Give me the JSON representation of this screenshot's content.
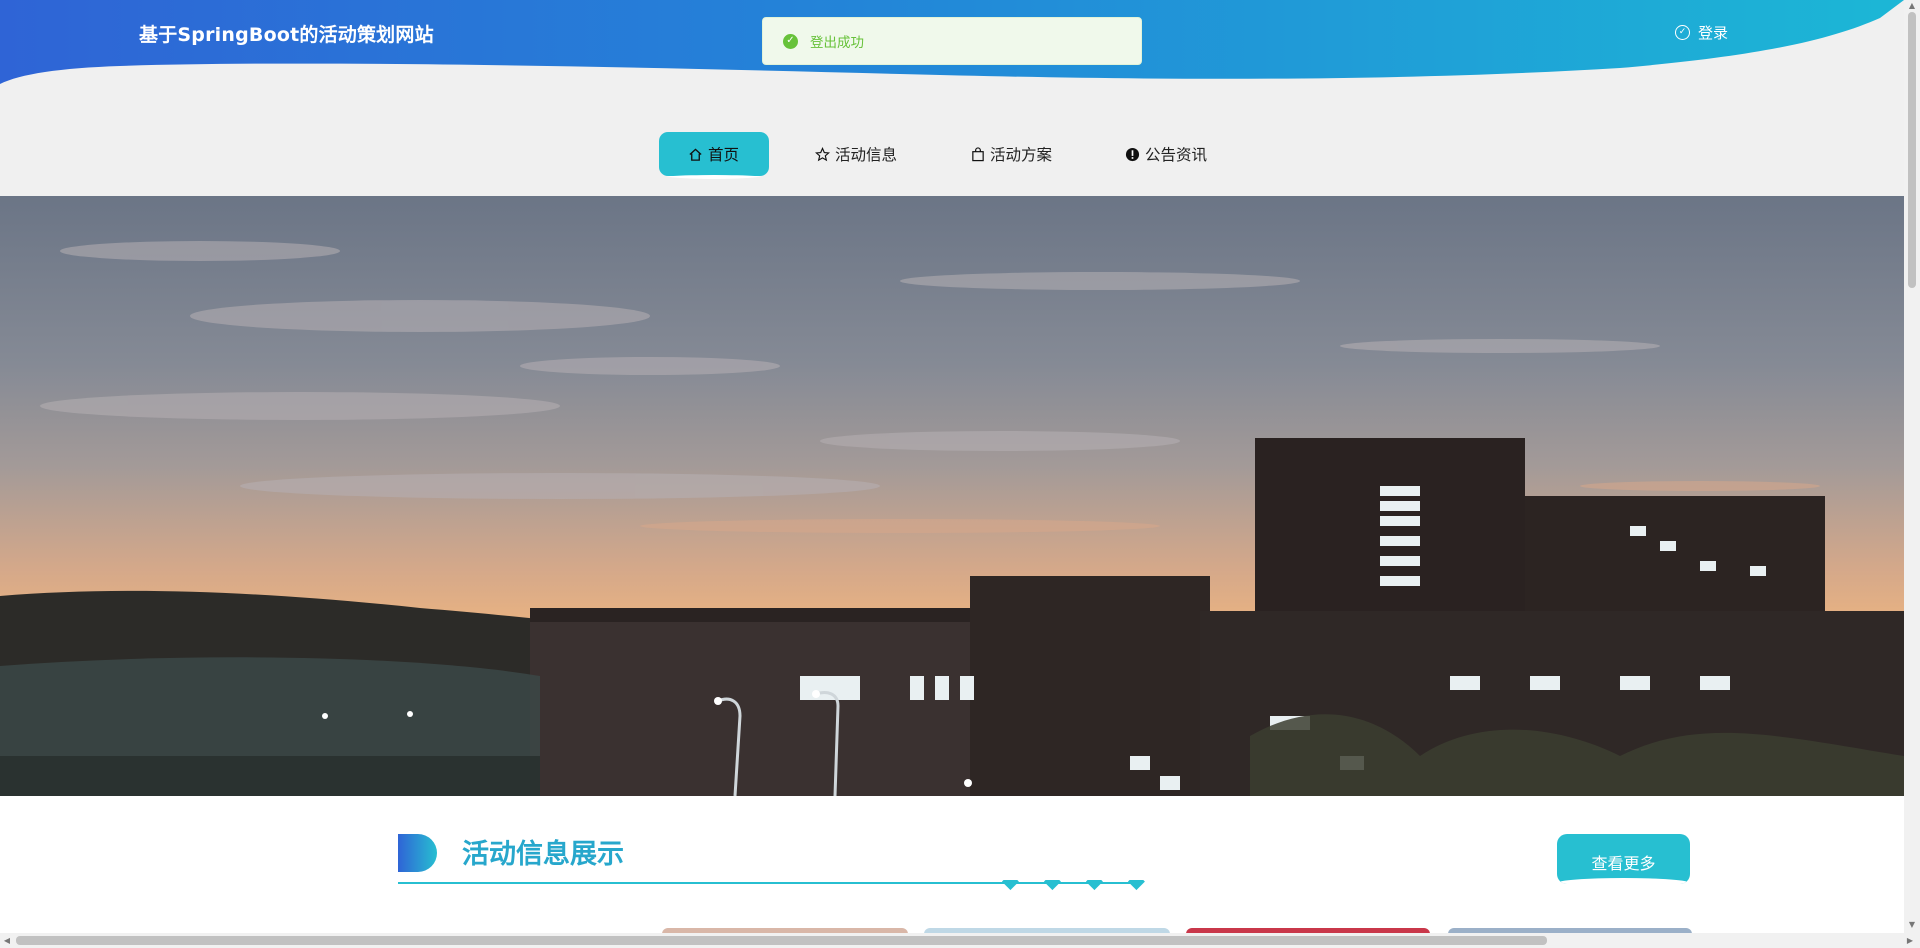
{
  "header": {
    "site_title": "基于SpringBoot的活动策划网站",
    "login_label": "登录"
  },
  "toast": {
    "message": "登出成功"
  },
  "nav": {
    "items": [
      {
        "label": "首页",
        "icon": "home-icon",
        "active": true
      },
      {
        "label": "活动信息",
        "icon": "star-icon",
        "active": false
      },
      {
        "label": "活动方案",
        "icon": "bag-icon",
        "active": false
      },
      {
        "label": "公告资讯",
        "icon": "info-circle-icon",
        "active": false
      }
    ]
  },
  "banner": {
    "slide_count": 1,
    "active_slide": 1
  },
  "section": {
    "title": "活动信息展示",
    "more_label": "查看更多"
  },
  "colors": {
    "accent": "#27bfd1",
    "header_gradient_start": "#2f64d6",
    "header_gradient_end": "#1cb3d6",
    "toast_success": "#67c23a"
  }
}
